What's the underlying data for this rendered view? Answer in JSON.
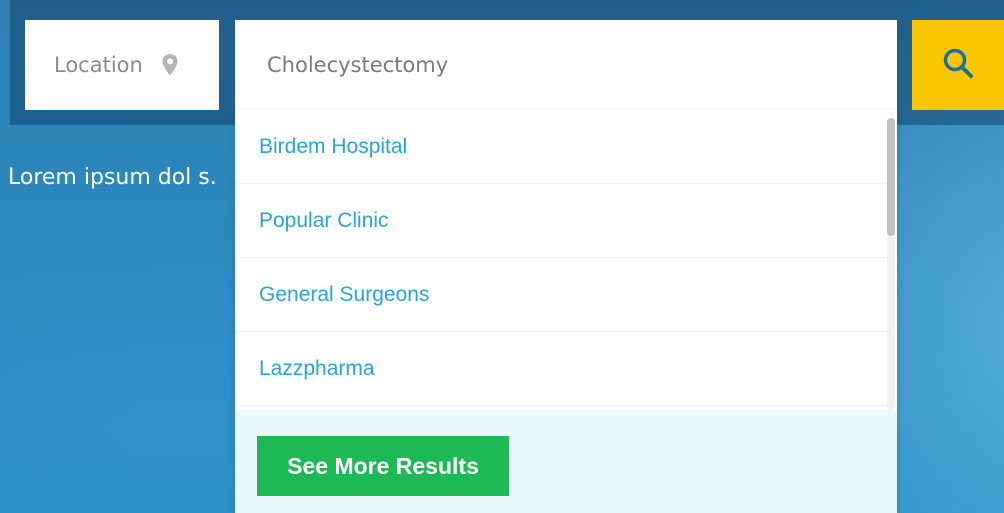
{
  "search": {
    "location_placeholder": "Location",
    "location_icon": "map-pin-icon",
    "query_value": "Cholecystectomy",
    "search_icon": "magnifier-icon"
  },
  "hero": {
    "tagline": "Lorem ipsum dol                                                                                  s."
  },
  "suggestions": {
    "items": [
      {
        "label": "Birdem Hospital"
      },
      {
        "label": "Popular Clinic"
      },
      {
        "label": "General Surgeons"
      },
      {
        "label": "Lazzpharma"
      }
    ],
    "more_label": "See More Results"
  },
  "colors": {
    "accent_yellow": "#f7c600",
    "link_blue": "#2aa3dc",
    "button_green": "#1db954",
    "hero_blue": "#2c88bd"
  }
}
